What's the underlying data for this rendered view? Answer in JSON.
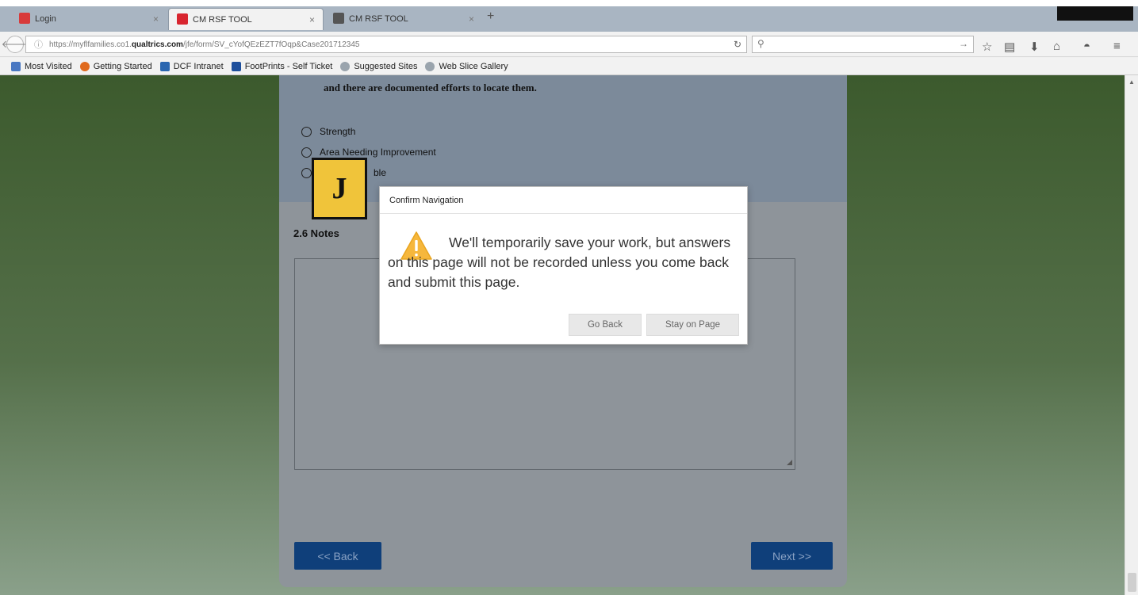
{
  "browser": {
    "tabs": [
      {
        "label": "Login",
        "favicon_color": "#d83a3a",
        "active": false
      },
      {
        "label": "CM RSF TOOL",
        "favicon_color": "#d8252f",
        "active": true
      },
      {
        "label": "CM RSF TOOL",
        "favicon_color": "#555555",
        "active": false
      }
    ],
    "url_prefix": "https://myflfamilies.co1.",
    "url_domain": "qualtrics.com",
    "url_path": "/jfe/form/SV_cYofQEzEZT7fOqp&Case201712345",
    "bookmarks": [
      {
        "label": "Most Visited",
        "color": "#4a78c2"
      },
      {
        "label": "Getting Started",
        "color": "#e06a1e"
      },
      {
        "label": "DCF Intranet",
        "color": "#2a66b0"
      },
      {
        "label": "FootPrints - Self Ticket",
        "color": "#1d4f9c"
      },
      {
        "label": "Suggested Sites",
        "color": "#9aa4ad"
      },
      {
        "label": "Web Slice Gallery",
        "color": "#9aa4ad"
      }
    ]
  },
  "form": {
    "question_text": "and there are documented efforts to locate them.",
    "options": [
      "Strength",
      "Area Needing Improvement",
      "ble"
    ],
    "notes_label": "2.6 Notes",
    "back_label": "<< Back",
    "next_label": "Next >>"
  },
  "marker": {
    "letter": "J"
  },
  "dialog": {
    "title": "Confirm Navigation",
    "message": "We'll temporarily save your work, but answers on this page will not be recorded unless you come back and submit this page.",
    "go_back_label": "Go Back",
    "stay_label": "Stay on Page"
  }
}
